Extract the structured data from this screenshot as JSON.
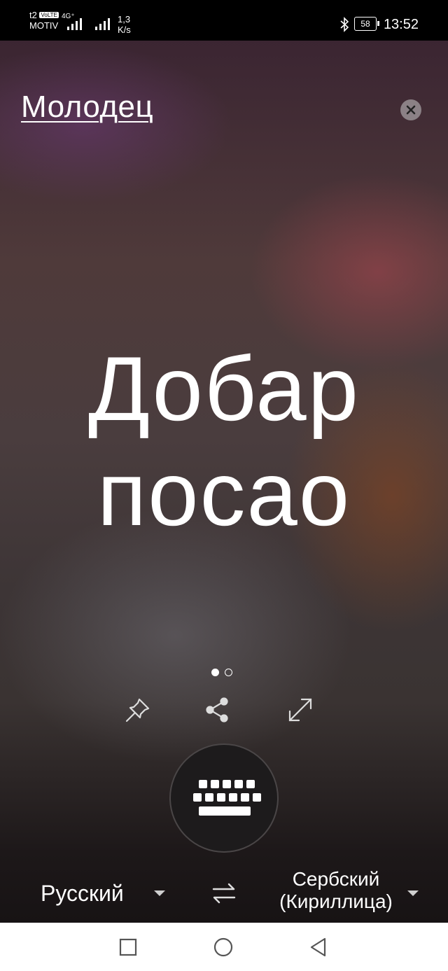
{
  "status_bar": {
    "carrier_top": "t2",
    "carrier_badge": "VoLTE",
    "carrier_bottom": "MOTIV",
    "network_type": "4G⁺",
    "speed_value": "1,3",
    "speed_unit": "K/s",
    "battery": "58",
    "time": "13:52"
  },
  "header": {
    "source_text": "Молодец",
    "close_icon": "close-icon"
  },
  "translation": {
    "line1": "Добар",
    "line2": "посао"
  },
  "pager": {
    "current": 1,
    "total": 2
  },
  "actions": {
    "pin_icon": "pin-icon",
    "share_icon": "share-icon",
    "expand_icon": "expand-icon",
    "keyboard_icon": "keyboard-icon"
  },
  "languages": {
    "source": "Русский",
    "swap_icon": "swap-icon",
    "target_line1": "Сербский",
    "target_line2": "(Кириллица)"
  },
  "nav_bar": {
    "recents_icon": "square-icon",
    "home_icon": "circle-icon",
    "back_icon": "triangle-back-icon"
  }
}
